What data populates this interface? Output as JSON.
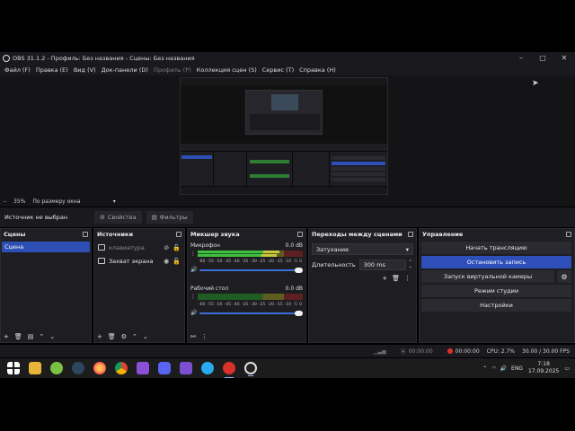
{
  "window": {
    "title": "OBS 31.1.2 - Профиль: Без названия - Сцены: Без названия",
    "controls": [
      "–",
      "▢",
      "✕"
    ]
  },
  "menu": [
    {
      "label": "Файл (F)",
      "enabled": true
    },
    {
      "label": "Правка (E)",
      "enabled": true
    },
    {
      "label": "Вид (V)",
      "enabled": true
    },
    {
      "label": "Док-панели (D)",
      "enabled": true
    },
    {
      "label": "Профиль (P)",
      "enabled": false
    },
    {
      "label": "Коллекция сцен (S)",
      "enabled": true
    },
    {
      "label": "Сервис (T)",
      "enabled": true
    },
    {
      "label": "Справка (H)",
      "enabled": true
    }
  ],
  "zoombar": {
    "minus": "–",
    "zoom": "35%",
    "fit": "По размеру окна"
  },
  "sourcebar": {
    "no_source": "Источник не выбран",
    "properties": "Свойства",
    "filters": "Фильтры"
  },
  "scenes": {
    "title": "Сцены",
    "items": [
      "Сцена"
    ]
  },
  "sources": {
    "title": "Источники",
    "items": [
      {
        "name": "клавиатура",
        "visible": false
      },
      {
        "name": "Захват экрана",
        "visible": true
      }
    ]
  },
  "mixer": {
    "title": "Микшер звука",
    "scale": [
      "-60",
      "-55",
      "-50",
      "-45",
      "-40",
      "-35",
      "-30",
      "-25",
      "-20",
      "-15",
      "-10",
      "-5",
      "0"
    ],
    "channels": [
      {
        "name": "Микрофон",
        "db": "0.0 dB",
        "level": 0.78,
        "volume": 1.0
      },
      {
        "name": "Рабочий стол",
        "db": "0.0 dB",
        "level": 0.0,
        "volume": 1.0
      }
    ]
  },
  "transitions": {
    "title": "Переходы между сценами",
    "selected": "Затухание",
    "duration_label": "Длительность",
    "duration_value": "300 ms"
  },
  "controls": {
    "title": "Управление",
    "start_stream": "Начать трансляцию",
    "stop_record": "Остановить запись",
    "virtual_cam": "Запуск виртуальной камеры",
    "studio_mode": "Режим студии",
    "settings": "Настройки"
  },
  "status": {
    "stream_time": "00:00:00",
    "record_time": "00:00:00",
    "cpu": "CPU: 2.7%",
    "fps": "30.00 / 30.00 FPS"
  },
  "taskbar": {
    "apps": [
      "windows-logo",
      "file-explorer",
      "utorrent",
      "steam",
      "firefox",
      "chrome",
      "app-purple",
      "discord",
      "app-cat",
      "telegram",
      "app-red",
      "obs"
    ],
    "lang": "ENG",
    "time": "7:18",
    "date": "17.09.2025"
  },
  "colors": {
    "accent": "#2e4fb8",
    "panel": "#1d1d22",
    "record_dot": "#e0302a"
  }
}
